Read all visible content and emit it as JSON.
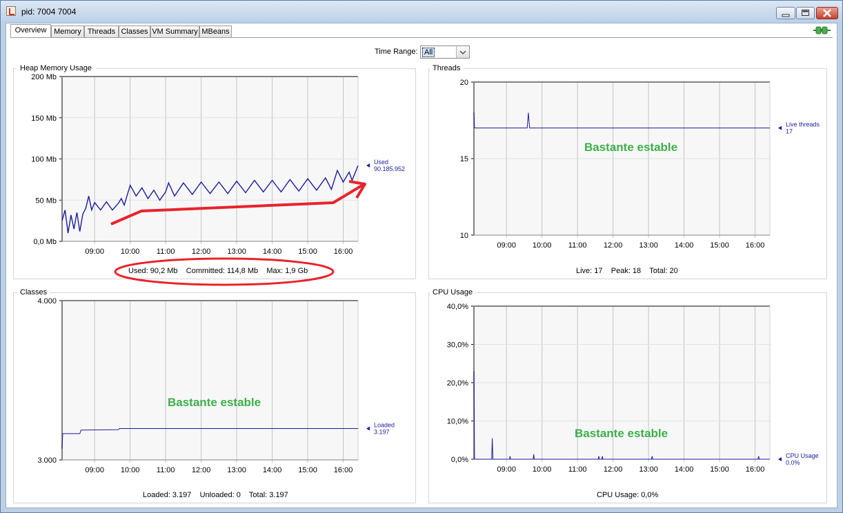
{
  "window": {
    "title": "pid: 7004 7004"
  },
  "tabs": [
    {
      "label": "Overview",
      "active": true
    },
    {
      "label": "Memory"
    },
    {
      "label": "Threads"
    },
    {
      "label": "Classes"
    },
    {
      "label": "VM Summary"
    },
    {
      "label": "MBeans"
    }
  ],
  "time_range": {
    "label": "Time Range:",
    "value": "All"
  },
  "panels": {
    "heap": {
      "title": "Heap Memory Usage",
      "summary": "Used: 90,2 Mb    Committed: 114,8 Mb    Max: 1,9 Gb",
      "legend_name": "Used",
      "legend_value": "90.185.952"
    },
    "threads": {
      "title": "Threads",
      "summary": "Live: 17    Peak: 18    Total: 20",
      "legend_name": "Live threads",
      "legend_value": "17",
      "note": "Bastante estable"
    },
    "classes": {
      "title": "Classes",
      "summary": "Loaded: 3.197    Unloaded: 0    Total: 3.197",
      "legend_name": "Loaded",
      "legend_value": "3.197",
      "note": "Bastante estable"
    },
    "cpu": {
      "title": "CPU Usage",
      "summary": "CPU Usage: 0,0%",
      "legend_name": "CPU Usage",
      "legend_value": "0.0%",
      "note": "Bastante estable"
    }
  },
  "chart_data": [
    {
      "id": "heap",
      "type": "line",
      "title": "Heap Memory Usage",
      "x_time_range": [
        "08:05",
        "16:25"
      ],
      "x_ticks": [
        "09:00",
        "10:00",
        "11:00",
        "12:00",
        "13:00",
        "14:00",
        "15:00",
        "16:00"
      ],
      "y_ticks": [
        "0,0 Mb",
        "50 Mb",
        "100 Mb",
        "150 Mb",
        "200 Mb"
      ],
      "ylim": [
        0,
        200
      ],
      "unit": "Mb",
      "grid": true,
      "series": [
        {
          "name": "Used",
          "color": "#1a1aa0",
          "points": [
            [
              "08:05",
              25
            ],
            [
              "08:10",
              38
            ],
            [
              "08:15",
              10
            ],
            [
              "08:20",
              32
            ],
            [
              "08:25",
              15
            ],
            [
              "08:30",
              35
            ],
            [
              "08:35",
              12
            ],
            [
              "08:40",
              33
            ],
            [
              "08:45",
              40
            ],
            [
              "08:50",
              55
            ],
            [
              "08:55",
              38
            ],
            [
              "09:00",
              47
            ],
            [
              "09:10",
              38
            ],
            [
              "09:20",
              48
            ],
            [
              "09:30",
              38
            ],
            [
              "09:40",
              46
            ],
            [
              "09:45",
              52
            ],
            [
              "09:50",
              44
            ],
            [
              "10:00",
              68
            ],
            [
              "10:10",
              55
            ],
            [
              "10:20",
              65
            ],
            [
              "10:30",
              52
            ],
            [
              "10:40",
              62
            ],
            [
              "10:50",
              50
            ],
            [
              "11:00",
              60
            ],
            [
              "11:05",
              71
            ],
            [
              "11:15",
              55
            ],
            [
              "11:30",
              71
            ],
            [
              "11:45",
              57
            ],
            [
              "12:00",
              72
            ],
            [
              "12:15",
              58
            ],
            [
              "12:30",
              72
            ],
            [
              "12:45",
              58
            ],
            [
              "13:00",
              73
            ],
            [
              "13:15",
              59
            ],
            [
              "13:30",
              74
            ],
            [
              "13:45",
              60
            ],
            [
              "14:00",
              74
            ],
            [
              "14:15",
              60
            ],
            [
              "14:30",
              75
            ],
            [
              "14:45",
              61
            ],
            [
              "15:00",
              76
            ],
            [
              "15:15",
              62
            ],
            [
              "15:30",
              77
            ],
            [
              "15:40",
              63
            ],
            [
              "15:50",
              86
            ],
            [
              "16:00",
              72
            ],
            [
              "16:10",
              84
            ],
            [
              "16:15",
              74
            ],
            [
              "16:25",
              92
            ]
          ]
        }
      ]
    },
    {
      "id": "threads",
      "type": "line",
      "title": "Threads",
      "x_time_range": [
        "08:05",
        "16:25"
      ],
      "x_ticks": [
        "09:00",
        "10:00",
        "11:00",
        "12:00",
        "13:00",
        "14:00",
        "15:00",
        "16:00"
      ],
      "y_ticks": [
        "10",
        "15",
        "20"
      ],
      "ylim": [
        10,
        20
      ],
      "grid": true,
      "series": [
        {
          "name": "Live threads",
          "color": "#1a1aa0",
          "points": [
            [
              "08:05",
              18
            ],
            [
              "08:06",
              17
            ],
            [
              "09:35",
              17
            ],
            [
              "09:37",
              18
            ],
            [
              "09:39",
              17
            ],
            [
              "16:25",
              17
            ]
          ]
        }
      ]
    },
    {
      "id": "classes",
      "type": "line",
      "title": "Classes",
      "x_time_range": [
        "08:05",
        "16:25"
      ],
      "x_ticks": [
        "09:00",
        "10:00",
        "11:00",
        "12:00",
        "13:00",
        "14:00",
        "15:00",
        "16:00"
      ],
      "y_ticks": [
        "3.000",
        "4.000"
      ],
      "ylim": [
        3000,
        4000
      ],
      "grid": true,
      "series": [
        {
          "name": "Loaded",
          "color": "#1a1aa0",
          "points": [
            [
              "08:05",
              3070
            ],
            [
              "08:06",
              3165
            ],
            [
              "08:35",
              3165
            ],
            [
              "08:37",
              3187
            ],
            [
              "09:40",
              3190
            ],
            [
              "09:42",
              3197
            ],
            [
              "16:25",
              3197
            ]
          ]
        }
      ]
    },
    {
      "id": "cpu",
      "type": "line",
      "title": "CPU Usage",
      "x_time_range": [
        "08:05",
        "16:25"
      ],
      "x_ticks": [
        "09:00",
        "10:00",
        "11:00",
        "12:00",
        "13:00",
        "14:00",
        "15:00",
        "16:00"
      ],
      "y_ticks": [
        "0,0%",
        "10,0%",
        "20,0%",
        "30,0%",
        "40,0%"
      ],
      "ylim": [
        0,
        40
      ],
      "grid": true,
      "series": [
        {
          "name": "CPU Usage",
          "color": "#1a1aa0",
          "points": [
            [
              "08:05",
              23
            ],
            [
              "08:06",
              0
            ],
            [
              "08:35",
              0
            ],
            [
              "08:36",
              5.5
            ],
            [
              "08:37",
              0
            ],
            [
              "09:05",
              0
            ],
            [
              "09:06",
              0.8
            ],
            [
              "09:07",
              0
            ],
            [
              "09:45",
              0
            ],
            [
              "09:46",
              1.3
            ],
            [
              "09:47",
              0
            ],
            [
              "11:35",
              0
            ],
            [
              "11:36",
              0.8
            ],
            [
              "11:37",
              0
            ],
            [
              "11:41",
              0
            ],
            [
              "11:42",
              0.8
            ],
            [
              "11:43",
              0
            ],
            [
              "13:05",
              0
            ],
            [
              "13:06",
              0.8
            ],
            [
              "13:07",
              0
            ],
            [
              "16:05",
              0
            ],
            [
              "16:06",
              0.8
            ],
            [
              "16:07",
              0
            ],
            [
              "16:25",
              0
            ]
          ]
        }
      ]
    }
  ]
}
